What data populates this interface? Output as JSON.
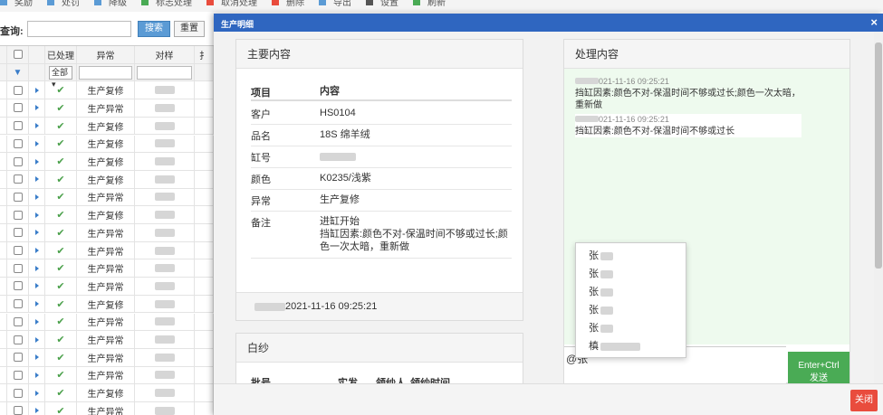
{
  "toolbar": {
    "items": [
      {
        "label": "奖励",
        "color": "#5b9bd5"
      },
      {
        "label": "处罚",
        "color": "#5b9bd5"
      },
      {
        "label": "降级",
        "color": "#5b9bd5"
      },
      {
        "label": "标志处理",
        "color": "#4aab55"
      },
      {
        "label": "取消处理",
        "color": "#e94c3d"
      },
      {
        "label": "删除",
        "color": "#e94c3d"
      },
      {
        "label": "导出",
        "color": "#5b9bd5"
      },
      {
        "label": "设置",
        "color": "#555555"
      },
      {
        "label": "刷新",
        "color": "#4aab55"
      }
    ]
  },
  "search": {
    "label": "查询:",
    "search_btn": "搜索",
    "reset_btn": "重置"
  },
  "grid": {
    "headers": {
      "processed": "已处理",
      "exception": "异常",
      "sample": "对样"
    },
    "filter_select": "全部",
    "rows": [
      {
        "processed": "✔",
        "exception": "生产复修"
      },
      {
        "processed": "✔",
        "exception": "生产异常"
      },
      {
        "processed": "✔",
        "exception": "生产复修"
      },
      {
        "processed": "✔",
        "exception": "生产复修"
      },
      {
        "processed": "✔",
        "exception": "生产复修"
      },
      {
        "processed": "✔",
        "exception": "生产复修"
      },
      {
        "processed": "✔",
        "exception": "生产异常"
      },
      {
        "processed": "✔",
        "exception": "生产复修"
      },
      {
        "processed": "✔",
        "exception": "生产异常"
      },
      {
        "processed": "✔",
        "exception": "生产异常"
      },
      {
        "processed": "✔",
        "exception": "生产异常"
      },
      {
        "processed": "✔",
        "exception": "生产异常"
      },
      {
        "processed": "✔",
        "exception": "生产复修"
      },
      {
        "processed": "✔",
        "exception": "生产异常"
      },
      {
        "processed": "✔",
        "exception": "生产异常"
      },
      {
        "processed": "✔",
        "exception": "生产异常"
      },
      {
        "processed": "✔",
        "exception": "生产异常"
      },
      {
        "processed": "✔",
        "exception": "生产复修"
      },
      {
        "processed": "✔",
        "exception": "生产异常"
      }
    ]
  },
  "modal": {
    "title": "生产明细",
    "close_icon": "×",
    "main": {
      "heading": "主要内容",
      "col_item": "项目",
      "col_content": "内容",
      "rows": [
        {
          "k": "客户",
          "v": "HS0104"
        },
        {
          "k": "品名",
          "v": "18S 绵羊绒"
        },
        {
          "k": "缸号",
          "v": ""
        },
        {
          "k": "颜色",
          "v": "K0235/浅紫"
        },
        {
          "k": "异常",
          "v": "生产复修"
        },
        {
          "k": "备注",
          "v": "进缸开始\n挡缸因素:颜色不对-保温时间不够或过长;颜色一次太暗，重新做"
        }
      ],
      "footer_time": "2021-11-16 09:25:21"
    },
    "yarn": {
      "heading": "白纱",
      "cols": [
        "批号",
        "实发",
        "领纱人",
        "领纱时间"
      ]
    },
    "process": {
      "heading": "处理内容",
      "messages": [
        {
          "time": "021-11-16 09:25:21",
          "text": "挡缸因素:颜色不对-保温时间不够或过长;颜色一次太暗，重新做"
        },
        {
          "time": "021-11-16 09:25:21",
          "text": "挡缸因素:颜色不对-保温时间不够或过长"
        }
      ],
      "mention_list": [
        "张",
        "张",
        "张",
        "张",
        "张",
        "槙"
      ],
      "input_value": "@张",
      "send_btn_line1": "Enter+Ctrl",
      "send_btn_line2": "发送"
    },
    "close_btn": "关闭"
  }
}
